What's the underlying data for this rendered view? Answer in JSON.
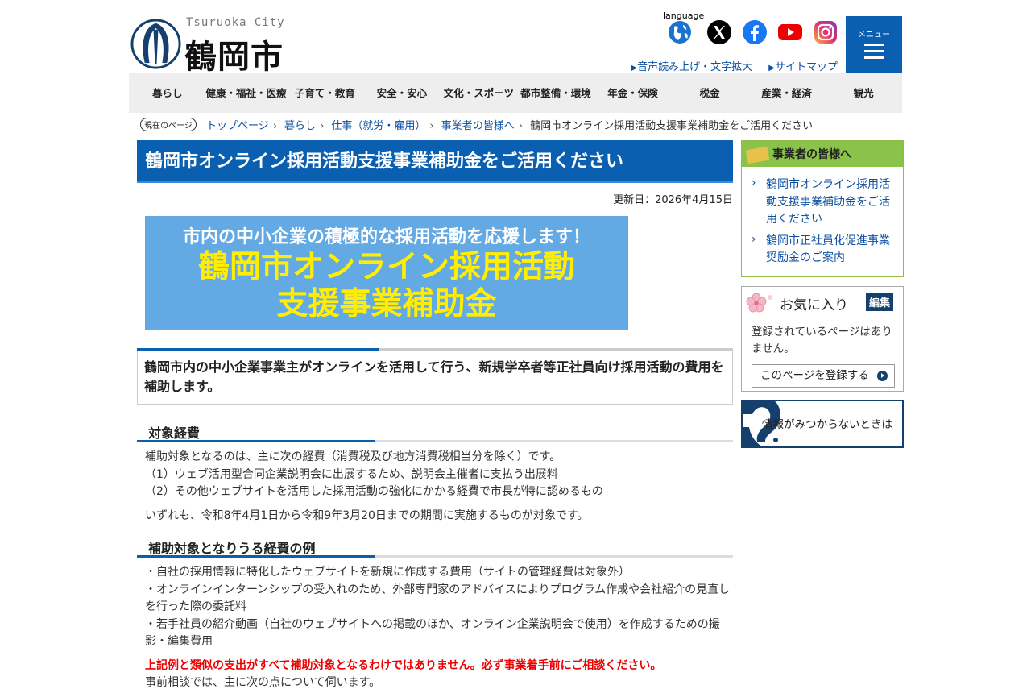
{
  "header": {
    "logo_en": "Tsuruoka City",
    "logo_ja": "鶴岡市",
    "language_label": "language",
    "links": [
      "音声読み上げ・文字拡大",
      "サイトマップ"
    ],
    "menu_label": "メニュー"
  },
  "nav": [
    "暮らし",
    "健康・福祉・医療",
    "子育て・教育",
    "安全・安心",
    "文化・スポーツ",
    "都市整備・環境",
    "年金・保険",
    "税金",
    "産業・経済",
    "観光"
  ],
  "breadcrumb": {
    "here_label": "現在のページ",
    "items": [
      "トップページ",
      "暮らし",
      "仕事（就労・雇用）",
      "事業者の皆様へ"
    ],
    "current": "鶴岡市オンライン採用活動支援事業補助金をご活用ください"
  },
  "main": {
    "title": "鶴岡市オンライン採用活動支援事業補助金をご活用ください",
    "updated": "更新日：2026年4月15日",
    "banner": {
      "line1": "市内の中小企業の積極的な採用活動を応援します！",
      "line2": "鶴岡市オンライン採用活動",
      "line3": "支援事業補助金"
    },
    "lead": "鶴岡市内の中小企業事業主がオンラインを活用して行う、新規学卒者等正社員向け採用活動の費用を補助します。",
    "section1": {
      "heading": "対象経費",
      "lines": [
        "補助対象となるのは、主に次の経費（消費税及び地方消費税相当分を除く）です。",
        "（1）ウェブ活用型合同企業説明会に出展するため、説明会主催者に支払う出展料",
        "（2）その他ウェブサイトを活用した採用活動の強化にかかる経費で市長が特に認めるもの"
      ],
      "note": "いずれも、令和8年4月1日から令和9年3月20日までの期間に実施するものが対象です。"
    },
    "section2": {
      "heading": "補助対象となりうる経費の例",
      "lines": [
        "・自社の採用情報に特化したウェブサイトを新規に作成する費用（サイトの管理経費は対象外）",
        "・オンラインインターンシップの受入れのため、外部専門家のアドバイスによりプログラム作成や会社紹介の見直しを行った際の委託料",
        "・若手社員の紹介動画（自社のウェブサイトへの掲載のほか、オンライン企業説明会で使用）を作成するための撮影・編集費用"
      ],
      "warning": "上記例と類似の支出がすべて補助対象となるわけではありません。必ず事業着手前にご相談ください。",
      "consult": "事前相談では、主に次の点について伺います。"
    }
  },
  "side": {
    "box1": {
      "heading": "事業者の皆様へ",
      "items": [
        "鶴岡市オンライン採用活動支援事業補助金をご活用ください",
        "鶴岡市正社員化促進事業奨励金のご案内"
      ]
    },
    "box2": {
      "heading": "お気に入り",
      "edit": "編集",
      "message": "登録されているページはありません。",
      "register": "このページを登録する"
    },
    "box3": {
      "text": "情報がみつからないときは"
    }
  }
}
